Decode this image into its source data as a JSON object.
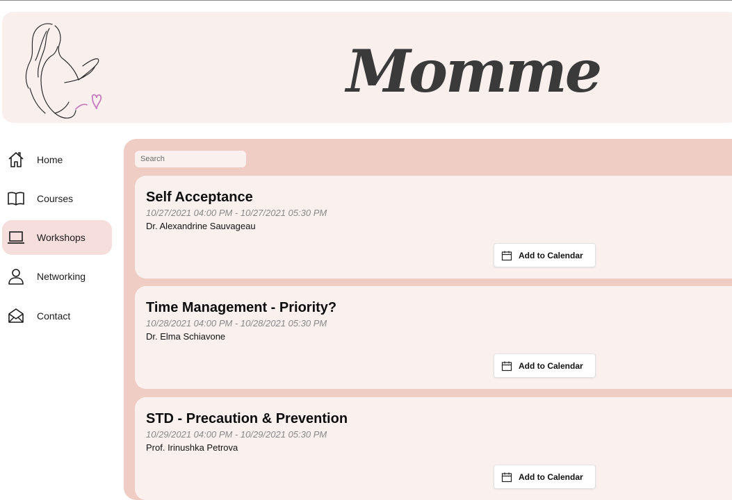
{
  "app": {
    "brand": "Momme"
  },
  "search": {
    "placeholder": "Search"
  },
  "sidebar": {
    "items": [
      {
        "label": "Home",
        "icon": "home-icon",
        "active": false
      },
      {
        "label": "Courses",
        "icon": "book-icon",
        "active": false
      },
      {
        "label": "Workshops",
        "icon": "laptop-icon",
        "active": true
      },
      {
        "label": "Networking",
        "icon": "person-icon",
        "active": false
      },
      {
        "label": "Contact",
        "icon": "envelope-icon",
        "active": false
      }
    ]
  },
  "workshops": [
    {
      "title": "Self Acceptance",
      "time": "10/27/2021 04:00 PM - 10/27/2021 05:30 PM",
      "host": "Dr. Alexandrine Sauvageau",
      "button": "Add to Calendar"
    },
    {
      "title": "Time Management - Priority?",
      "time": "10/28/2021 04:00 PM - 10/28/2021 05:30 PM",
      "host": "Dr. Elma Schiavone",
      "button": "Add to Calendar"
    },
    {
      "title": "STD - Precaution & Prevention",
      "time": "10/29/2021 04:00 PM - 10/29/2021 05:30 PM",
      "host": "Prof. Irinushka Petrova",
      "button": "Add to Calendar"
    }
  ],
  "colors": {
    "header_bg": "#f9f0ee",
    "content_bg": "#efcdc4",
    "card_bg": "#faf1ef",
    "active_nav": "#f6dedc",
    "brand_text": "#3a3a3a",
    "accent_heart": "#c77bbf"
  }
}
